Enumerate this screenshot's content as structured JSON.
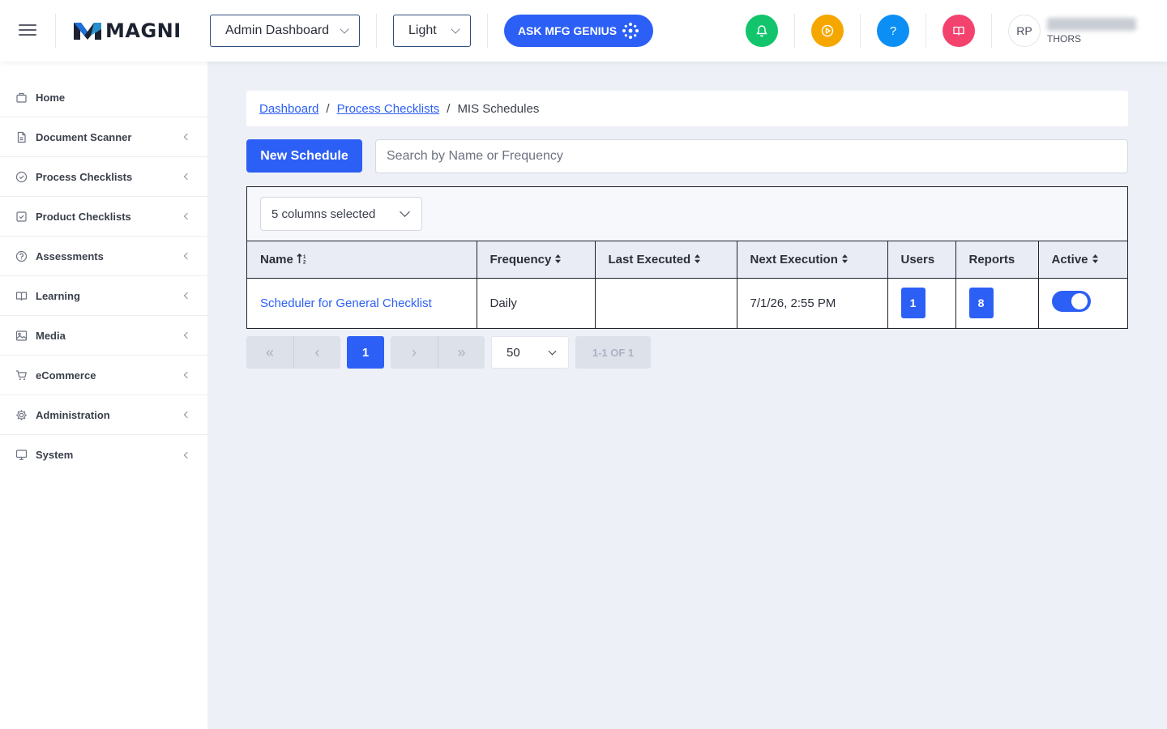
{
  "header": {
    "logo_text": "MAGNI",
    "dashboard_select": "Admin Dashboard",
    "theme_select": "Light",
    "ask_button": "ASK MFG GENIUS",
    "user_initials": "RP",
    "user_org": "THORS",
    "colors": {
      "accent": "#2c5ff5",
      "notification": "#12c46b",
      "video": "#f5a700",
      "help": "#0b8ff5",
      "docs": "#f2426d"
    }
  },
  "sidebar": {
    "items": [
      {
        "label": "Home",
        "icon": "home-icon"
      },
      {
        "label": "Document Scanner",
        "icon": "document-icon"
      },
      {
        "label": "Process Checklists",
        "icon": "check-circle-icon"
      },
      {
        "label": "Product Checklists",
        "icon": "check-square-icon"
      },
      {
        "label": "Assessments",
        "icon": "question-circle-icon"
      },
      {
        "label": "Learning",
        "icon": "book-icon"
      },
      {
        "label": "Media",
        "icon": "image-icon"
      },
      {
        "label": "eCommerce",
        "icon": "cart-icon"
      },
      {
        "label": "Administration",
        "icon": "gear-icon"
      },
      {
        "label": "System",
        "icon": "monitor-icon"
      }
    ]
  },
  "breadcrumb": {
    "items": [
      "Dashboard",
      "Process Checklists"
    ],
    "current": "MIS Schedules"
  },
  "actions": {
    "new_button": "New Schedule",
    "search_placeholder": "Search by Name or Frequency"
  },
  "table": {
    "columns_selected": "5 columns selected",
    "headers": [
      "Name",
      "Frequency",
      "Last Executed",
      "Next Execution",
      "Users",
      "Reports",
      "Active"
    ],
    "rows": [
      {
        "name": "Scheduler for General Checklist",
        "frequency": "Daily",
        "last_executed": "",
        "next_execution": "7/1/26, 2:55 PM",
        "users": "1",
        "reports": "8",
        "active": true
      }
    ]
  },
  "pagination": {
    "current_page": "1",
    "page_size": "50",
    "info": "1-1 OF 1"
  }
}
